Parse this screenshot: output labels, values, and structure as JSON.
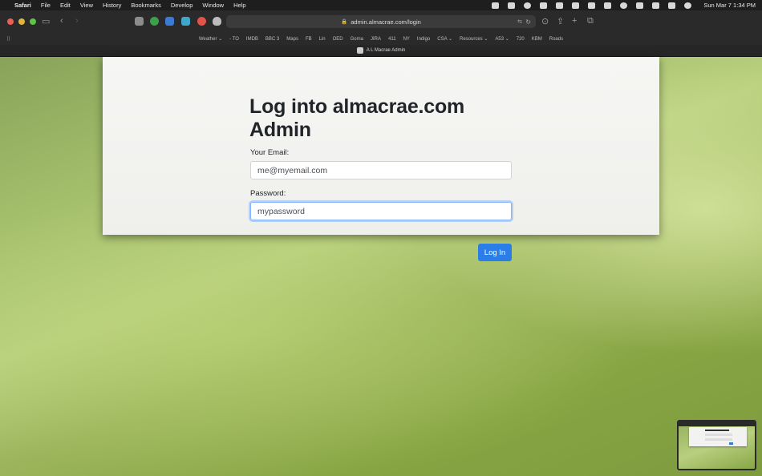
{
  "menubar": {
    "app": "Safari",
    "items": [
      "File",
      "Edit",
      "View",
      "History",
      "Bookmarks",
      "Develop",
      "Window",
      "Help"
    ],
    "clock": "Sun Mar 7  1:34 PM"
  },
  "toolbar": {
    "url": "admin.almacrae.com/login"
  },
  "favorites": [
    "Weather ⌄",
    "- TO",
    "IMDB",
    "BBC 3",
    "Maps",
    "FB",
    "Lin",
    "OED",
    "Goma",
    "JIRA",
    "411",
    "NY",
    "Indigo",
    "CSA ⌄",
    "Resources ⌄",
    "A53 ⌄",
    "720",
    "KBM",
    "Roads"
  ],
  "tab": {
    "title": "A L Macrae Admin"
  },
  "login": {
    "heading": "Log into almacrae.com Admin",
    "email_label": "Your Email:",
    "email_value": "me@myemail.com",
    "password_label": "Password:",
    "password_value": "mypassword",
    "submit_label": "Log In"
  },
  "colors": {
    "button": "#2b7de8",
    "page_bg": "#f4f4f2",
    "chrome": "#2a2a2a"
  }
}
